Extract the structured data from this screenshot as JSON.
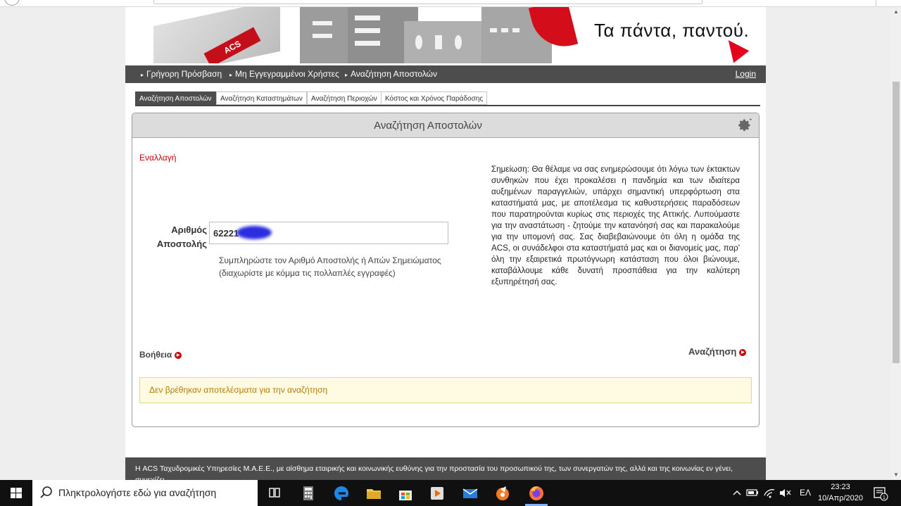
{
  "banner": {
    "logo_text": "ACS",
    "tagline": "Τα πάντα, παντού."
  },
  "nav": {
    "items": [
      {
        "label": "Γρήγορη Πρόσβαση"
      },
      {
        "label": "Μη Εγγεγραμμένοι Χρήστες"
      },
      {
        "label": "Αναζήτηση Αποστολών"
      }
    ],
    "login": "Login"
  },
  "tabs": [
    {
      "label": "Αναζήτηση Αποστολών",
      "active": true
    },
    {
      "label": "Αναζήτηση Καταστημάτων"
    },
    {
      "label": "Αναζήτηση Περιοχών"
    },
    {
      "label": "Κόστος και Χρόνος Παράδοσης"
    }
  ],
  "panel": {
    "title": "Αναζήτηση Αποστολών",
    "toggle_link": "Εναλλαγή",
    "field_label": "Αριθμός Αποστολής",
    "field_value": "62221",
    "field_hint": "Συμπληρώστε τον Αριθμό Αποστολής ή Απών Σημειώματος (διαχωρίστε με κόμμα τις πολλαπλές εγγραφές)",
    "notice": "Σημείωση: Θα θέλαμε να σας ενημερώσουμε ότι λόγω των έκτακτων συνθηκών που έχει προκαλέσει η πανδημία και των ιδιαίτερα αυξημένων παραγγελιών, υπάρχει σημαντική υπερφόρτωση στα καταστήματά μας, με αποτέλεσμα τις καθυστερήσεις παραδόσεων που παρατηρούνται κυρίως στις περιοχές της Αττικής. Λυπούμαστε για την αναστάτωση - ζητούμε την κατανόησή σας και παρακαλούμε για την υπομονή σας. Σας διαβεβαιώνουμε ότι όλη η ομάδα της ACS, οι συνάδελφοι στα καταστήματά μας και οι διανομείς μας, παρ' όλη την εξαιρετικά πρωτόγνωρη κατάσταση που όλοι βιώνουμε, καταβάλλουμε κάθε δυνατή προσπάθεια για την καλύτερη εξυπηρέτησή σας.",
    "help_link": "Βοήθεια",
    "search_link": "Αναζήτηση",
    "result_message": "Δεν βρέθηκαν αποτελέσματα για την αναζήτηση"
  },
  "footer": {
    "text": "Η ACS Ταχυδρομικές Υπηρεσίες Μ.Α.Ε.Ε., με αίσθημα εταιρικής και κοινωνικής ευθύνης για την προστασία του προσωπικού της, των συνεργατών της, αλλά και της κοινωνίας εν γένει, συνεχίζει"
  },
  "taskbar": {
    "search_placeholder": "Πληκτρολογήστε εδώ για αναζήτηση",
    "language": "ΕΛ",
    "time": "23:23",
    "date": "10/Απρ/2020",
    "notification_count": "1"
  },
  "colors": {
    "brand_red": "#cc0000",
    "nav_dark": "#4d4d4d",
    "result_text": "#b47b00",
    "result_bg": "#fffbe3"
  }
}
